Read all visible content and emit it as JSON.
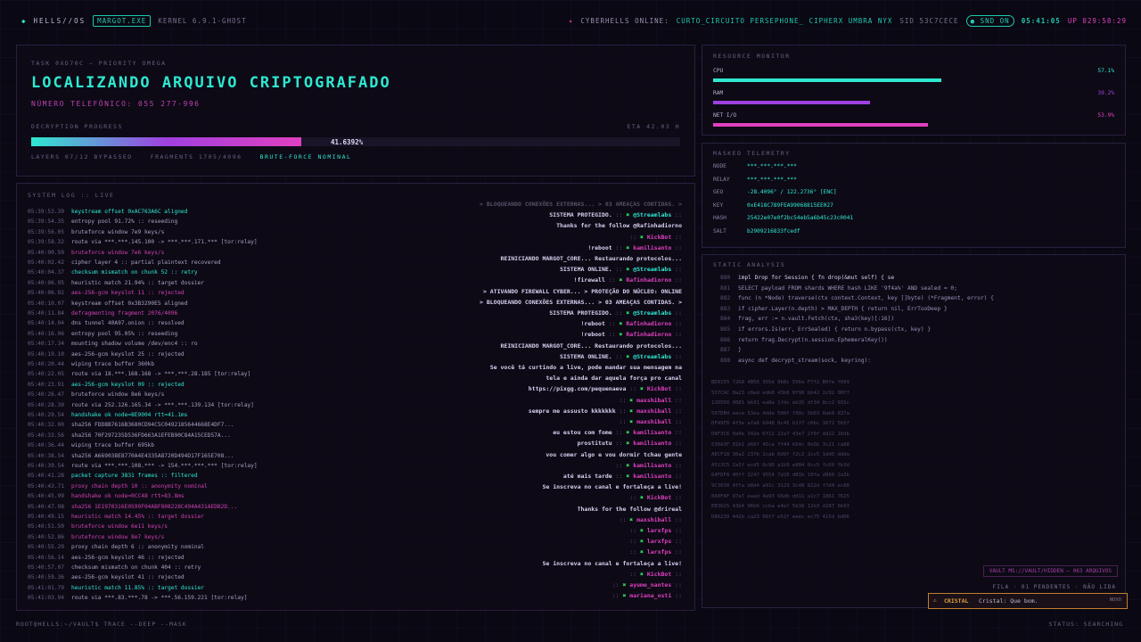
{
  "topbar": {
    "brand": "HELLS//OS",
    "chip": "MARGOT.EXE",
    "kernel": "KERNEL 6.9.1-GHOST",
    "online_label": "CYBERHELLS ONLINE:",
    "online_users": "CURTO_CIRCUITO  PERSEPHONE_  CIPHERX  UMBRA  NYX",
    "sid": "SID 53C7CECE",
    "snd": "SND ON",
    "clock": "05:41:05",
    "uptime": "UP 029:58:29"
  },
  "task": {
    "label": "TASK 0XD70C — PRIORITY OMEGA",
    "title": "LOCALIZANDO ARQUIVO CRIPTOGRAFADO",
    "phone": "NÚMERO TELEFÔNICO: 055 277-996",
    "progress_label": "DECRYPTION PROGRESS",
    "eta": "ETA 42.03 H",
    "progress_pct": 41.6392,
    "progress_text": "41.6392%",
    "layers": "LAYERS 07/12 BYPASSED",
    "fragments": "FRAGMENTS 1705/4096",
    "mode": "BRUTE-FORCE NOMINAL"
  },
  "log": {
    "label": "SYSTEM LOG :: LIVE",
    "lines": [
      {
        "t": "05:39:53.39",
        "m": "keystream offset 0xAC763A6C aligned",
        "c": "cyan"
      },
      {
        "t": "05:39:54.35",
        "m": "entropy pool 91.72% :: reseeding",
        "c": "n"
      },
      {
        "t": "05:39:56.05",
        "m": "bruteforce window 7e9 keys/s",
        "c": "n"
      },
      {
        "t": "05:39:58.32",
        "m": "route via ***.***.145.100 -> ***.***.171.*** [tor:relay]",
        "c": "n"
      },
      {
        "t": "05:40:00.59",
        "m": "bruteforce window 7e6 keys/s",
        "c": "pink"
      },
      {
        "t": "05:40:02.42",
        "m": "cipher layer 4 :: partial plaintext recovered",
        "c": "n"
      },
      {
        "t": "05:40:04.37",
        "m": "checksum mismatch on chunk 52 :: retry",
        "c": "cyan"
      },
      {
        "t": "05:40:06.95",
        "m": "heuristic match 21.94% :: target dossier",
        "c": "n"
      },
      {
        "t": "05:40:06.92",
        "m": "aes-256-gcm keyslot 11 :: rejected",
        "c": "pink"
      },
      {
        "t": "05:40:10.07",
        "m": "keystream offset 0x3B3290E5 aligned",
        "c": "n"
      },
      {
        "t": "05:40:11.84",
        "m": "defragmenting fragment 2076/4096",
        "c": "pink"
      },
      {
        "t": "05:40:14.04",
        "m": "dns tunnel 40A97.onion :: resolved",
        "c": "n"
      },
      {
        "t": "05:40:16.06",
        "m": "entropy pool 95.05% :: reseeding",
        "c": "n"
      },
      {
        "t": "05:40:17.34",
        "m": "mounting shadow volume /dev/enc4 :: ro",
        "c": "n"
      },
      {
        "t": "05:40:19.10",
        "m": "aes-256-gcm keyslot 25 :: rejected",
        "c": "n"
      },
      {
        "t": "05:40:20.44",
        "m": "wiping trace buffer 360kb",
        "c": "n"
      },
      {
        "t": "05:40:22.05",
        "m": "route via 18.***.168.168 -> ***.***.28.185 [tor:relay]",
        "c": "n"
      },
      {
        "t": "05:40:23.91",
        "m": "aes-256-gcm keyslot 09 :: rejected",
        "c": "cyan"
      },
      {
        "t": "05:40:26.47",
        "m": "bruteforce window 8e6 keys/s",
        "c": "n"
      },
      {
        "t": "05:40:28.39",
        "m": "route via 252.126.165.34 -> ***.***.139.134 [tor:relay]",
        "c": "n"
      },
      {
        "t": "05:40:29.54",
        "m": "handshake ok node=8E9004 rtt=41.1ms",
        "c": "cyan"
      },
      {
        "t": "05:40:32.00",
        "m": "sha256 FDD8B7616B3680CD94C5C0492185644668E4DF7...",
        "c": "n"
      },
      {
        "t": "05:40:33.56",
        "m": "sha256 70F297235D536FD663A1EFEB90C84A15CED57A...",
        "c": "n"
      },
      {
        "t": "05:40:36.44",
        "m": "wiping trace buffer 695kb",
        "c": "n"
      },
      {
        "t": "05:40:38.54",
        "m": "sha256 A669038E8770A4E4335A8720D494D17F165E708...",
        "c": "n"
      },
      {
        "t": "05:40:39.54",
        "m": "route via ***.***.108.*** -> 154.***.***.*** [tor:relay]",
        "c": "n"
      },
      {
        "t": "05:40:41.28",
        "m": "packet capture 3831 frames :: filtered",
        "c": "cyan"
      },
      {
        "t": "05:40:43.71",
        "m": "proxy chain depth 10 :: anonymity nominal",
        "c": "pink"
      },
      {
        "t": "05:40:45.99",
        "m": "handshake ok node=0CC48 rtt=83.8ms",
        "c": "pink"
      },
      {
        "t": "05:40:47.98",
        "m": "sha256 1E1970316E0599F04ABF808228C494A431AEDB2D...",
        "c": "pink"
      },
      {
        "t": "05:40:49.15",
        "m": "heuristic match 14.45% :: target dossier",
        "c": "pink"
      },
      {
        "t": "05:40:51.50",
        "m": "bruteforce window 6e11 keys/s",
        "c": "pink"
      },
      {
        "t": "05:40:52.86",
        "m": "bruteforce window 8e7 keys/s",
        "c": "pink"
      },
      {
        "t": "05:40:55.29",
        "m": "proxy chain depth 6 :: anonymity nominal",
        "c": "n"
      },
      {
        "t": "05:40:56.14",
        "m": "aes-256-gcm keyslot 46 :: rejected",
        "c": "n"
      },
      {
        "t": "05:40:57.07",
        "m": "checksum mismatch on chunk 404 :: retry",
        "c": "n"
      },
      {
        "t": "05:40:59.36",
        "m": "aes-256-gcm keyslot 41 :: rejected",
        "c": "n"
      },
      {
        "t": "05:41:01.79",
        "m": "heuristic match 11.85% :: target dossier",
        "c": "cyan"
      },
      {
        "t": "05:41:03.94",
        "m": "route via ***.83.***.78 -> ***.56.159.221 [tor:relay]",
        "c": "n"
      }
    ]
  },
  "chat": [
    {
      "m": "> BLOQUEANDO CONEXÕES EXTERNAS... > 03 AMEAÇAS CONTIDAS. >",
      "u": ""
    },
    {
      "m": "SISTEMA PROTEGIDO.",
      "u": "@Streamlabs"
    },
    {
      "m": "Thanks for the follow @Rafinhadiorno",
      "u": ""
    },
    {
      "m": "",
      "u": "KickBot"
    },
    {
      "m": "!reboot",
      "u": "kamilisanto"
    },
    {
      "m": "REINICIANDO MARGOT_CORE... Restaurando protocolos...",
      "u": ""
    },
    {
      "m": "SISTEMA ONLINE.",
      "u": "@Streamlabs"
    },
    {
      "m": "!firewall",
      "u": "Rafinhadiorno"
    },
    {
      "m": "> ATIVANDO FIREWALL CYBER... > PROTEÇÃO DO NÚCLEO: ONLINE",
      "u": ""
    },
    {
      "m": "> BLOQUEANDO CONEXÕES EXTERNAS... > 03 AMEAÇAS CONTIDAS. >",
      "u": ""
    },
    {
      "m": "SISTEMA PROTEGIDO.",
      "u": "@Streamlabs"
    },
    {
      "m": "!reboot",
      "u": "Rafinhadiorno"
    },
    {
      "m": "!reboot",
      "u": "Rafinhadiorno"
    },
    {
      "m": "REINICIANDO MARGOT_CORE... Restaurando protocolos...",
      "u": ""
    },
    {
      "m": "SISTEMA ONLINE.",
      "u": "@Streamlabs"
    },
    {
      "m": "Se você tá curtindo a live, pode mandar sua mensagem na",
      "u": ""
    },
    {
      "m": "tela e ainda dar aquela força pro canal",
      "u": ""
    },
    {
      "m": "https://pixgg.com/pequenaeva",
      "u": "KickBot"
    },
    {
      "m": "",
      "u": "maxshiball"
    },
    {
      "m": "sempre me assusto kkkkkkk",
      "u": "maxshiball"
    },
    {
      "m": "",
      "u": "maxshiball"
    },
    {
      "m": "eu estou com fome",
      "u": "kamilisanto"
    },
    {
      "m": "prostitutu",
      "u": "kamilisanto"
    },
    {
      "m": "vou comer algo e vou dormir tchau gente",
      "u": ""
    },
    {
      "m": "",
      "u": "kamilisanto"
    },
    {
      "m": "até mais tarde",
      "u": "kamilisanto"
    },
    {
      "m": "Se inscreva no canal e fortaleça a live!",
      "u": ""
    },
    {
      "m": "",
      "u": "KickBot"
    },
    {
      "m": "Thanks for the follow @drireal",
      "u": ""
    },
    {
      "m": "",
      "u": "maxshiball"
    },
    {
      "m": "",
      "u": "larxfps"
    },
    {
      "m": "",
      "u": "larxfps"
    },
    {
      "m": "",
      "u": "larxfps"
    },
    {
      "m": "Se inscreva no canal e fortaleça a live!",
      "u": ""
    },
    {
      "m": "",
      "u": "KickBot"
    },
    {
      "m": "",
      "u": "ayume_nantes"
    },
    {
      "m": "",
      "u": "mariana_osti"
    }
  ],
  "resources": {
    "label": "RESOURCE MONITOR",
    "items": [
      {
        "name": "CPU",
        "value": 57.1,
        "text": "57.1%",
        "color": "#2ee8d0"
      },
      {
        "name": "RAM",
        "value": 39.2,
        "text": "39.2%",
        "color": "#a040e0"
      },
      {
        "name": "NET I/O",
        "value": 53.9,
        "text": "53.9%",
        "color": "#e040c0"
      }
    ]
  },
  "telemetry": {
    "label": "MASKED TELEMETRY",
    "rows": [
      {
        "k": "NODE",
        "v": "***.***.***.***"
      },
      {
        "k": "RELAY",
        "v": "***.***.***.***"
      },
      {
        "k": "GEO",
        "v": "-28.4096° / 122.2736° [ENC]"
      },
      {
        "k": "KEY",
        "v": "0xE418C789FEA99068815EE027"
      },
      {
        "k": "HASH",
        "v": "25422e07e0f2bc54eb5a6b45c23c0041"
      },
      {
        "k": "SALT",
        "v": "b2909216833fcedf"
      }
    ]
  },
  "static": {
    "label": "STATIC ANALYSIS",
    "code": [
      {
        "n": "880",
        "c": "impl Drop for Session { fn drop(&mut self) { se"
      },
      {
        "n": "881",
        "c": "SELECT payload FROM shards WHERE hash LIKE '9f4a%' AND sealed = 0;"
      },
      {
        "n": "882",
        "c": "func (n *Node) traverse(ctx context.Context, key []byte) (*Fragment, error) {"
      },
      {
        "n": "883",
        "c": "if cipher.Layer(n.depth) > MAX_DEPTH { return nil, ErrTooDeep }"
      },
      {
        "n": "884",
        "c": "frag, err := n.vault.Fetch(ctx, sha3(key)[:16])"
      },
      {
        "n": "885",
        "c": "if errors.Is(err, ErrSealed) { return n.bypass(ctx, key) }"
      },
      {
        "n": "886",
        "c": "return frag.Decrypt(n.session.EphemeralKey())"
      },
      {
        "n": "887",
        "c": "}"
      },
      {
        "n": "888",
        "c": "async def decrypt_stream(sock, keyring):"
      }
    ],
    "hex": [
      "BD9155 7268 4B56 355d 9b8c 556a F7f2 B0fe f099",
      "537CAC 0a23 c8ed edb8 43b6 0f98 bb42 2c92 00f7",
      "12D5D0 0681 bb31 ea8a 1fdc eb35 df34 8cc2 931c",
      "597DB4 eeca 53ea 4dda 500f f99c 5b63 8ab9 837a",
      "DF49FD 4f3e afa6 b948 0c45 b1f7 c6bc 3672 5b5f",
      "D8F3C6 0a9e 342e 6f12 22a7 43e7 2f0f dd22 16db",
      "538A3F 81b1 d60f 45ca 7f44 b54c 0e5b 3c21 ca88",
      "AECF18 36a2 237b 2cab 0d9f f2c2 2cc5 1dd5 ddda",
      "A513C5 2a3f ecd5 6c90 a1b9 e884 0cc5 fc69 fb3d",
      "64FDFA 40ff 3247 9554 7d28 d81b 10fa d960 2a3b",
      "9C3030 4ffa d8d4 a91c 3123 3c48 812d f7d4 ec88",
      "0A0FAF 87a7 eaad 4a93 66db dd11 a1c7 1861 7625",
      "EB3025 43b4 96b6 ccba e4ef 5b38 12b3 d287 6b93",
      "D86239 442b ca23 06ff e52f eeec ec75 415d bd06"
    ]
  },
  "vault": {
    "path": "VAULT MS://VAULT/HIDDEN — 063 ARQUIVOS",
    "queue": "FILA · 01 PENDENTES · NÃO LIDA"
  },
  "toast": {
    "title": "CRISTAL",
    "msg": "Cristal: Que bom.",
    "tag": "NOVO"
  },
  "bottom": {
    "prompt": "ROOT@HELLS:~/VAULT$ TRACE --DEEP --MASK",
    "status": "STATUS: SEARCHING"
  }
}
